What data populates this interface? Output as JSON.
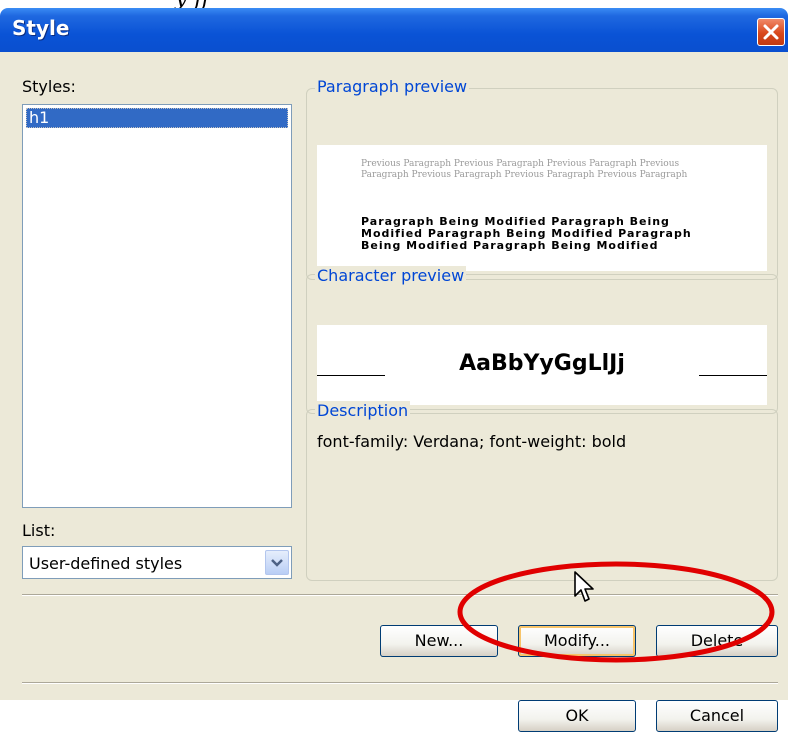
{
  "document": {
    "partial_text": "y  ff"
  },
  "window": {
    "title": "Style"
  },
  "styles": {
    "label": "Styles:",
    "items": [
      "h1"
    ]
  },
  "list": {
    "label": "List:",
    "selected": "User-defined styles"
  },
  "paragraph_preview": {
    "caption": "Paragraph preview",
    "previous_text": "Previous Paragraph Previous Paragraph Previous Paragraph Previous Paragraph Previous Paragraph Previous Paragraph Previous Paragraph",
    "modified_text": "Paragraph Being Modified Paragraph Being Modified Paragraph Being Modified Paragraph Being Modified Paragraph Being Modified"
  },
  "character_preview": {
    "caption": "Character preview",
    "sample": "AaBbYyGgLlJj"
  },
  "description": {
    "caption": "Description",
    "text": "font-family: Verdana; font-weight: bold"
  },
  "buttons": {
    "new": "New...",
    "modify": "Modify...",
    "delete": "Delete",
    "ok": "OK",
    "cancel": "Cancel"
  },
  "colors": {
    "titlebar": "#0a53d6",
    "dialog_bg": "#ece9d8",
    "selection": "#316ac5",
    "caption": "#0046d5",
    "annotation": "#e00000"
  },
  "icons": {
    "close": "close-icon",
    "dropdown": "chevron-down-icon",
    "cursor": "mouse-pointer-icon"
  }
}
